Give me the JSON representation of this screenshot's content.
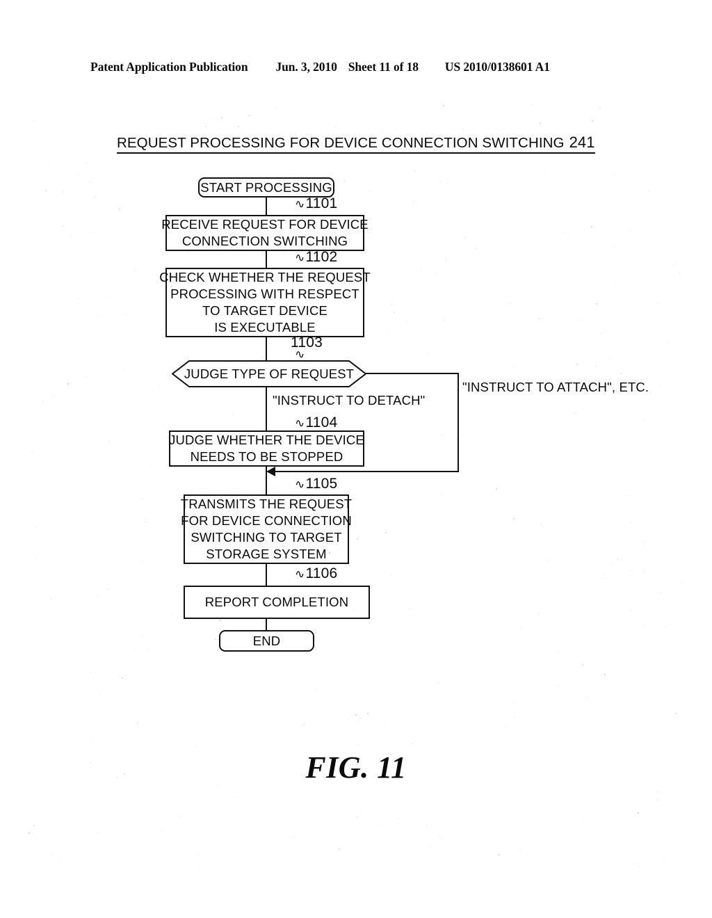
{
  "header": {
    "publication": "Patent Application Publication",
    "date": "Jun. 3, 2010",
    "sheet": "Sheet 11 of 18",
    "patent_number": "US 2010/0138601 A1"
  },
  "figure": {
    "title": "REQUEST PROCESSING FOR DEVICE CONNECTION SWITCHING",
    "title_reference": "241",
    "caption": "FIG. 11"
  },
  "flowchart": {
    "type": "flowchart",
    "start": {
      "label": "START PROCESSING",
      "shape": "terminator"
    },
    "end": {
      "label": "END",
      "shape": "terminator"
    },
    "steps": [
      {
        "ref": "1101",
        "shape": "process",
        "lines": [
          "RECEIVE REQUEST FOR DEVICE",
          "CONNECTION SWITCHING"
        ]
      },
      {
        "ref": "1102",
        "shape": "process",
        "lines": [
          "CHECK WHETHER THE REQUEST",
          "PROCESSING WITH RESPECT",
          "TO TARGET DEVICE",
          "IS EXECUTABLE"
        ]
      },
      {
        "ref": "1103",
        "shape": "decision",
        "lines": [
          "JUDGE TYPE OF REQUEST"
        ]
      },
      {
        "ref": "1104",
        "shape": "process",
        "lines": [
          "JUDGE WHETHER THE DEVICE",
          "NEEDS TO BE STOPPED"
        ]
      },
      {
        "ref": "1105",
        "shape": "process",
        "lines": [
          "TRANSMITS THE REQUEST",
          "FOR DEVICE CONNECTION",
          "SWITCHING TO TARGET",
          "STORAGE SYSTEM"
        ]
      },
      {
        "ref": "1106",
        "shape": "process",
        "lines": [
          "REPORT COMPLETION"
        ]
      }
    ],
    "branches": [
      {
        "from": "1103",
        "label_lines": [
          "\"INSTRUCT TO DETACH\""
        ],
        "side": "down"
      },
      {
        "from": "1103",
        "label_lines": [
          "\"INSTRUCT",
          "TO ATTACH\", ETC."
        ],
        "side": "right"
      }
    ],
    "tilde_symbol": "∿"
  }
}
